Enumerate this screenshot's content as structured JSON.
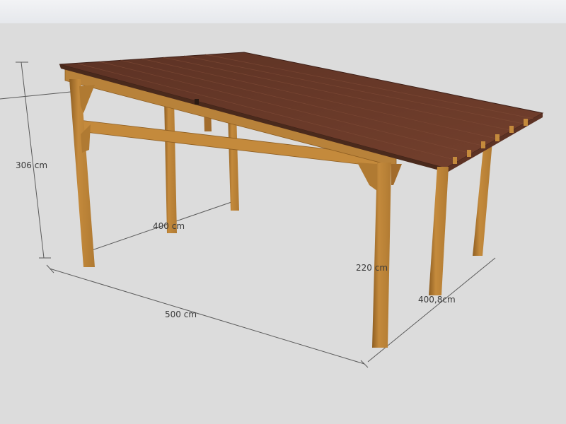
{
  "window": {
    "top_bar": ""
  },
  "dimensions": {
    "height_total": "306 cm",
    "depth_inner": "400 cm",
    "length": "500 cm",
    "post_height": "220 cm",
    "depth": "400,8cm"
  },
  "colors": {
    "background": "#dcdcdc",
    "roof": "#6a3a2a",
    "wood": "#c48a3c",
    "wood_dark": "#8e5e22",
    "dimension_line": "#555555"
  }
}
